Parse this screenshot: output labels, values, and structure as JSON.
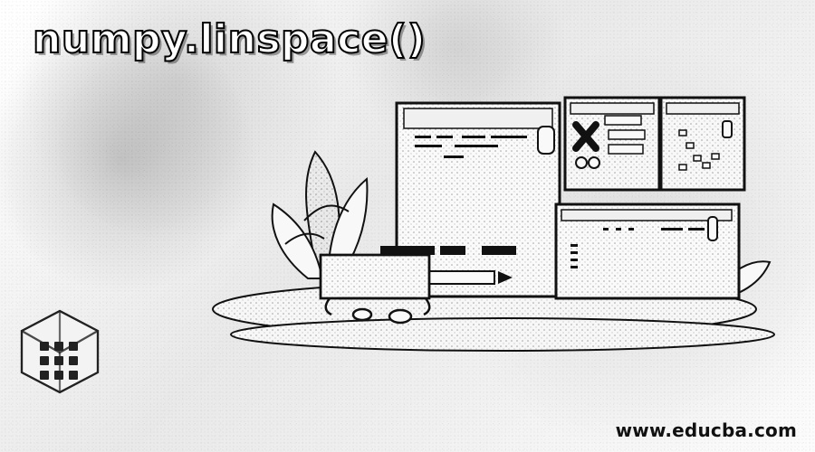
{
  "title": "numpy.linspace()",
  "website": "www.educba.com",
  "logo": {
    "icon": "educba-cube-logo"
  },
  "illustration": {
    "icon": "developer-workspace-illustration"
  },
  "colors": {
    "text": "#111111",
    "title_fill": "#ffffff",
    "title_outline": "#000000",
    "background": "#f2f2f2"
  }
}
